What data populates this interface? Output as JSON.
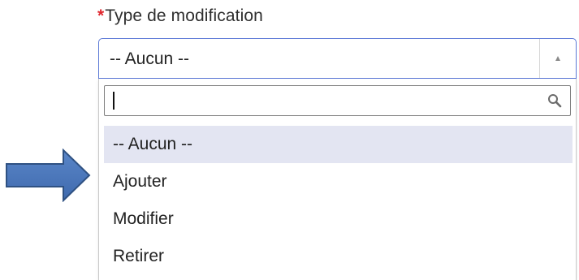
{
  "field": {
    "required_mark": "*",
    "label": "Type de modification"
  },
  "select": {
    "selected_value": "-- Aucun --",
    "expanded": true
  },
  "dropdown": {
    "search_value": "",
    "options": [
      {
        "label": "-- Aucun --",
        "highlighted": true
      },
      {
        "label": "Ajouter",
        "highlighted": false
      },
      {
        "label": "Modifier",
        "highlighted": false
      },
      {
        "label": "Retirer",
        "highlighted": false
      }
    ]
  },
  "annotation": {
    "arrow_color": "#4b77be",
    "arrow_border_color": "#2f5182",
    "points_to": "Ajouter"
  },
  "colors": {
    "required": "#e0262d",
    "focus_border": "#5b78d6",
    "highlight": "#e3e5f2"
  }
}
